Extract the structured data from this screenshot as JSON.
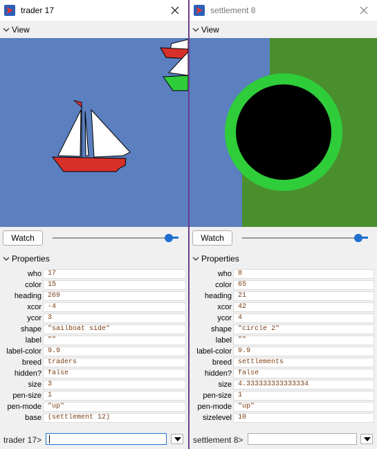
{
  "colors": {
    "window_bg": "#f0f0f0",
    "sea": "#5b7fbf",
    "land": "#4a8f2e",
    "settlement_ring": "#2fcd3a",
    "boat_hull": "#d7302a",
    "accent": "#1f6fd0",
    "field_text": "#7a3e12",
    "divider": "#6a3d8f"
  },
  "left": {
    "title": "trader 17",
    "view_label": "View",
    "watch_label": "Watch",
    "properties_label": "Properties",
    "properties": [
      {
        "label": "who",
        "value": "17"
      },
      {
        "label": "color",
        "value": "15"
      },
      {
        "label": "heading",
        "value": "269"
      },
      {
        "label": "xcor",
        "value": "-4"
      },
      {
        "label": "ycor",
        "value": "3"
      },
      {
        "label": "shape",
        "value": "\"sailboat side\""
      },
      {
        "label": "label",
        "value": "\"\""
      },
      {
        "label": "label-color",
        "value": "9.9"
      },
      {
        "label": "breed",
        "value": "traders"
      },
      {
        "label": "hidden?",
        "value": "false"
      },
      {
        "label": "size",
        "value": "3"
      },
      {
        "label": "pen-size",
        "value": "1"
      },
      {
        "label": "pen-mode",
        "value": "\"up\""
      },
      {
        "label": "base",
        "value": "(settlement 12)"
      }
    ],
    "command_prompt": "trader 17>",
    "command_value": ""
  },
  "right": {
    "title": "settlement 8",
    "view_label": "View",
    "watch_label": "Watch",
    "properties_label": "Properties",
    "properties": [
      {
        "label": "who",
        "value": "8"
      },
      {
        "label": "color",
        "value": "65"
      },
      {
        "label": "heading",
        "value": "21"
      },
      {
        "label": "xcor",
        "value": "42"
      },
      {
        "label": "ycor",
        "value": "4"
      },
      {
        "label": "shape",
        "value": "\"circle 2\""
      },
      {
        "label": "label",
        "value": "\"\""
      },
      {
        "label": "label-color",
        "value": "9.9"
      },
      {
        "label": "breed",
        "value": "settlements"
      },
      {
        "label": "hidden?",
        "value": "false"
      },
      {
        "label": "size",
        "value": "4.333333333333334"
      },
      {
        "label": "pen-size",
        "value": "1"
      },
      {
        "label": "pen-mode",
        "value": "\"up\""
      },
      {
        "label": "sizelevel",
        "value": "10"
      }
    ],
    "command_prompt": "settlement 8>",
    "command_value": ""
  },
  "icons": {
    "app": "netlogo-app-icon",
    "close": "close-icon",
    "collapse": "chevron-down-icon",
    "dropdown": "dropdown-arrow-icon"
  }
}
